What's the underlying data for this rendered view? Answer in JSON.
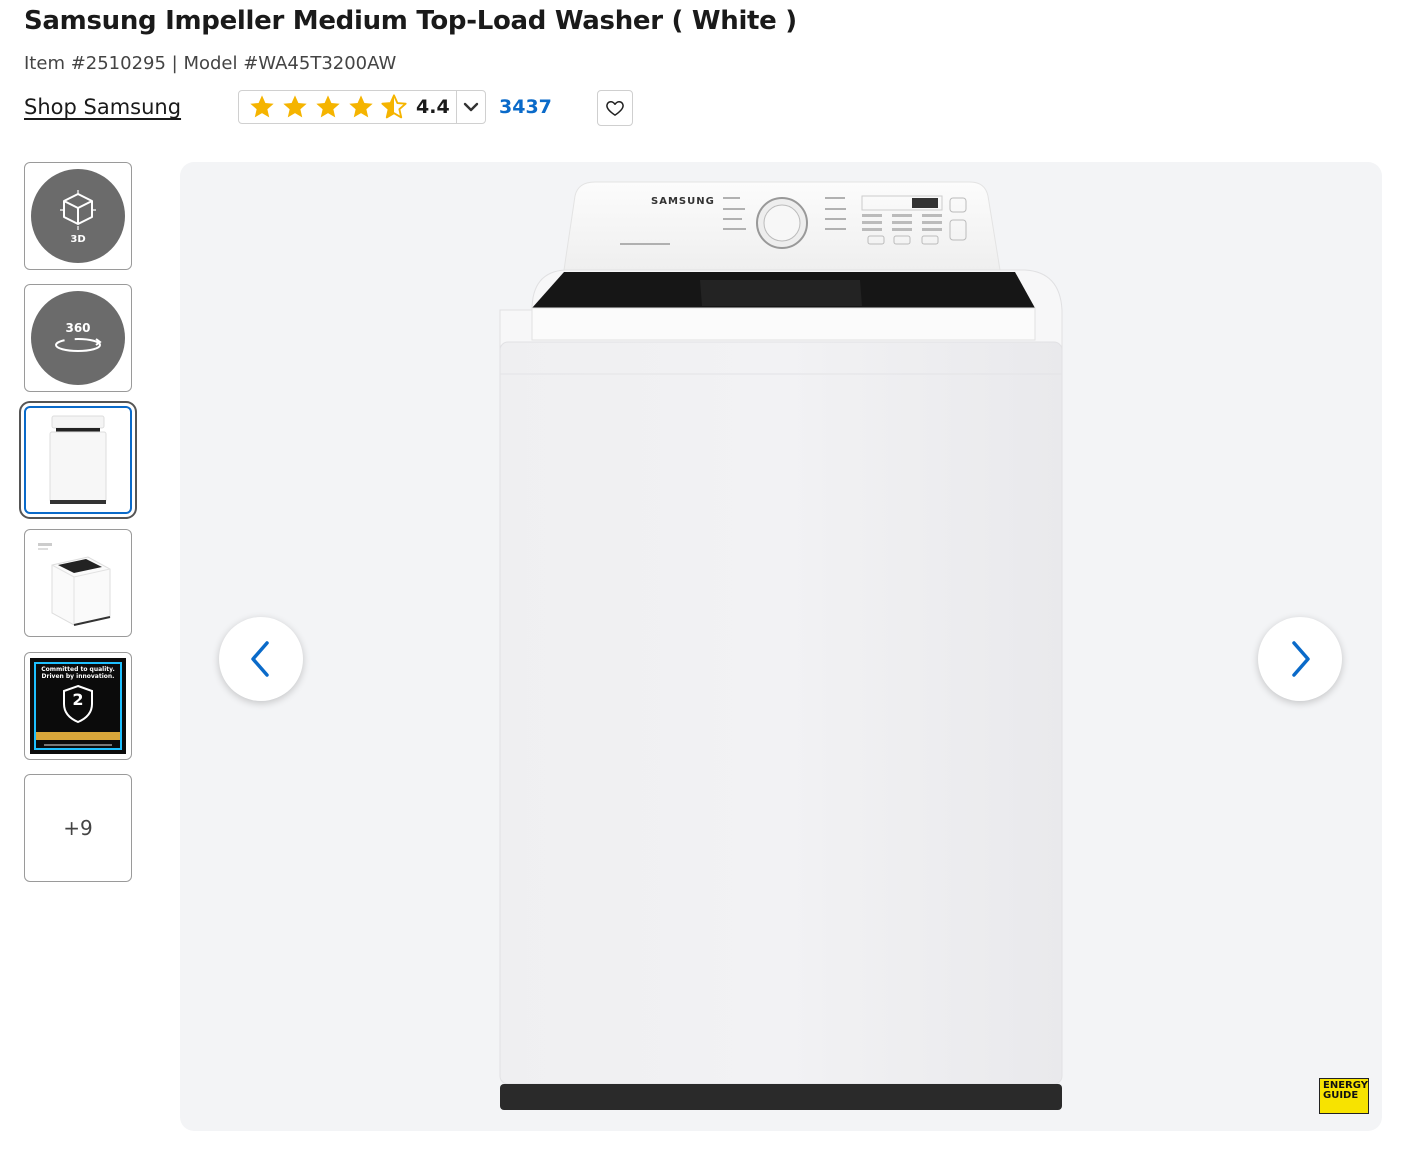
{
  "product": {
    "title": "Samsung Impeller Medium Top-Load Washer ( White )",
    "meta": "Item #2510295 | Model #WA45T3200AW",
    "shop_link": "Shop Samsung",
    "rating": "4.4",
    "rating_fraction": 0.88,
    "review_count": "3437",
    "brand_logo": "SAMSUNG"
  },
  "thumbnails": {
    "three_d_label": "3D",
    "three_sixty_label": "360",
    "warranty_heading": "Committed to quality. Driven by innovation.",
    "warranty_years": "2",
    "more_label": "+9"
  },
  "energy_guide_label": "ENERGY GUIDE",
  "colors": {
    "star": "#f5b400",
    "link": "#0a6ac9",
    "image_bg": "#f3f4f6"
  },
  "icons": {
    "star": "star-icon",
    "chevron_down": "chevron-down-icon",
    "heart": "heart-icon",
    "prev": "chevron-left-icon",
    "next": "chevron-right-icon",
    "cube": "cube-3d-icon",
    "rotate": "rotate-360-icon"
  }
}
